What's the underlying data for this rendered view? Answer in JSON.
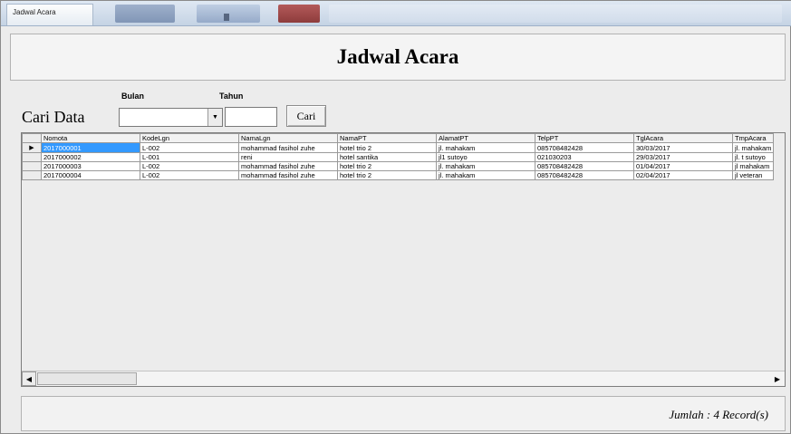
{
  "window": {
    "tab_title": "Jadwal Acara"
  },
  "header": {
    "title": "Jadwal Acara"
  },
  "search": {
    "label": "Cari Data",
    "bulan_label": "Bulan",
    "tahun_label": "Tahun",
    "bulan_value": "",
    "tahun_value": "",
    "button_label": "Cari",
    "dropdown_icon": "chevron-down-icon"
  },
  "grid": {
    "columns": [
      "Nomota",
      "KodeLgn",
      "NamaLgn",
      "NamaPT",
      "AlamatPT",
      "TelpPT",
      "TglAcara",
      "TmpAcara"
    ],
    "rows": [
      [
        "2017000001",
        "L-002",
        "mohammad fasihol zuhe",
        "hotel trio 2",
        "jl. mahakam",
        "085708482428",
        "30/03/2017",
        "jl. mahakam"
      ],
      [
        "2017000002",
        "L-001",
        "reni",
        "hotel santika",
        "jl1 sutoyo",
        "021030203",
        "29/03/2017",
        "jl. t sutoyo"
      ],
      [
        "2017000003",
        "L-002",
        "mohammad fasihol zuhe",
        "hotel trio 2",
        "jl. mahakam",
        "085708482428",
        "01/04/2017",
        "jl mahakam"
      ],
      [
        "2017000004",
        "L-002",
        "mohammad fasihol zuhe",
        "hotel trio 2",
        "jl. mahakam",
        "085708482428",
        "02/04/2017",
        "jl veteran"
      ]
    ],
    "selected_row": 0,
    "current_row_icon": "row-pointer-icon"
  },
  "footer": {
    "record_count": "Jumlah : 4 Record(s)"
  },
  "colors": {
    "selection": "#3399ff",
    "window_bg": "#ececec"
  }
}
